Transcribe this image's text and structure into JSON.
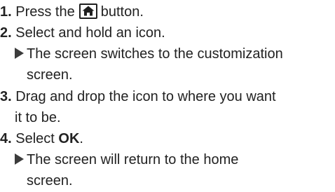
{
  "steps": [
    {
      "number": "1.",
      "text_before": "Press the",
      "icon": "home-icon",
      "text_after": "button."
    },
    {
      "number": "2.",
      "text": "Select and hold an icon.",
      "result_lines": [
        "The screen switches to the customization",
        "screen."
      ]
    },
    {
      "number": "3.",
      "lines": [
        "Drag and drop the icon to where you want",
        "it to be."
      ]
    },
    {
      "number": "4.",
      "text_before": "Select",
      "bold": "OK",
      "text_after": ".",
      "result_lines": [
        "The screen will return to the home",
        "screen."
      ]
    }
  ]
}
